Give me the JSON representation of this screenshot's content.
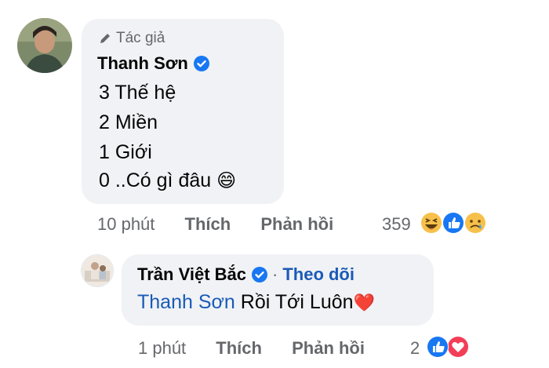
{
  "comment1": {
    "author_label": "Tác giả",
    "name": "Thanh Sơn",
    "lines": [
      "3 Thế hệ",
      "2 Miền",
      "1 Giới",
      "0 ..Có gì đâu"
    ],
    "emoji": "😄",
    "time": "10 phút",
    "like_label": "Thích",
    "reply_label": "Phản hồi",
    "reaction_count": "359",
    "reactions": [
      "haha-icon",
      "like-icon",
      "sad-icon"
    ]
  },
  "comment2": {
    "name": "Trần Việt Bắc",
    "separator": "·",
    "follow_label": "Theo dõi",
    "mention": "Thanh Sơn",
    "text": " Rồi Tới Luôn",
    "heart": "❤️",
    "time": "1 phút",
    "like_label": "Thích",
    "reply_label": "Phản hồi",
    "reaction_count": "2",
    "reactions": [
      "like-icon",
      "love-icon"
    ]
  },
  "colors": {
    "bubble": "#f0f2f5",
    "link": "#1a5ab8",
    "muted": "#65676b",
    "like_blue": "#1877f2",
    "love_red": "#f33e58"
  }
}
